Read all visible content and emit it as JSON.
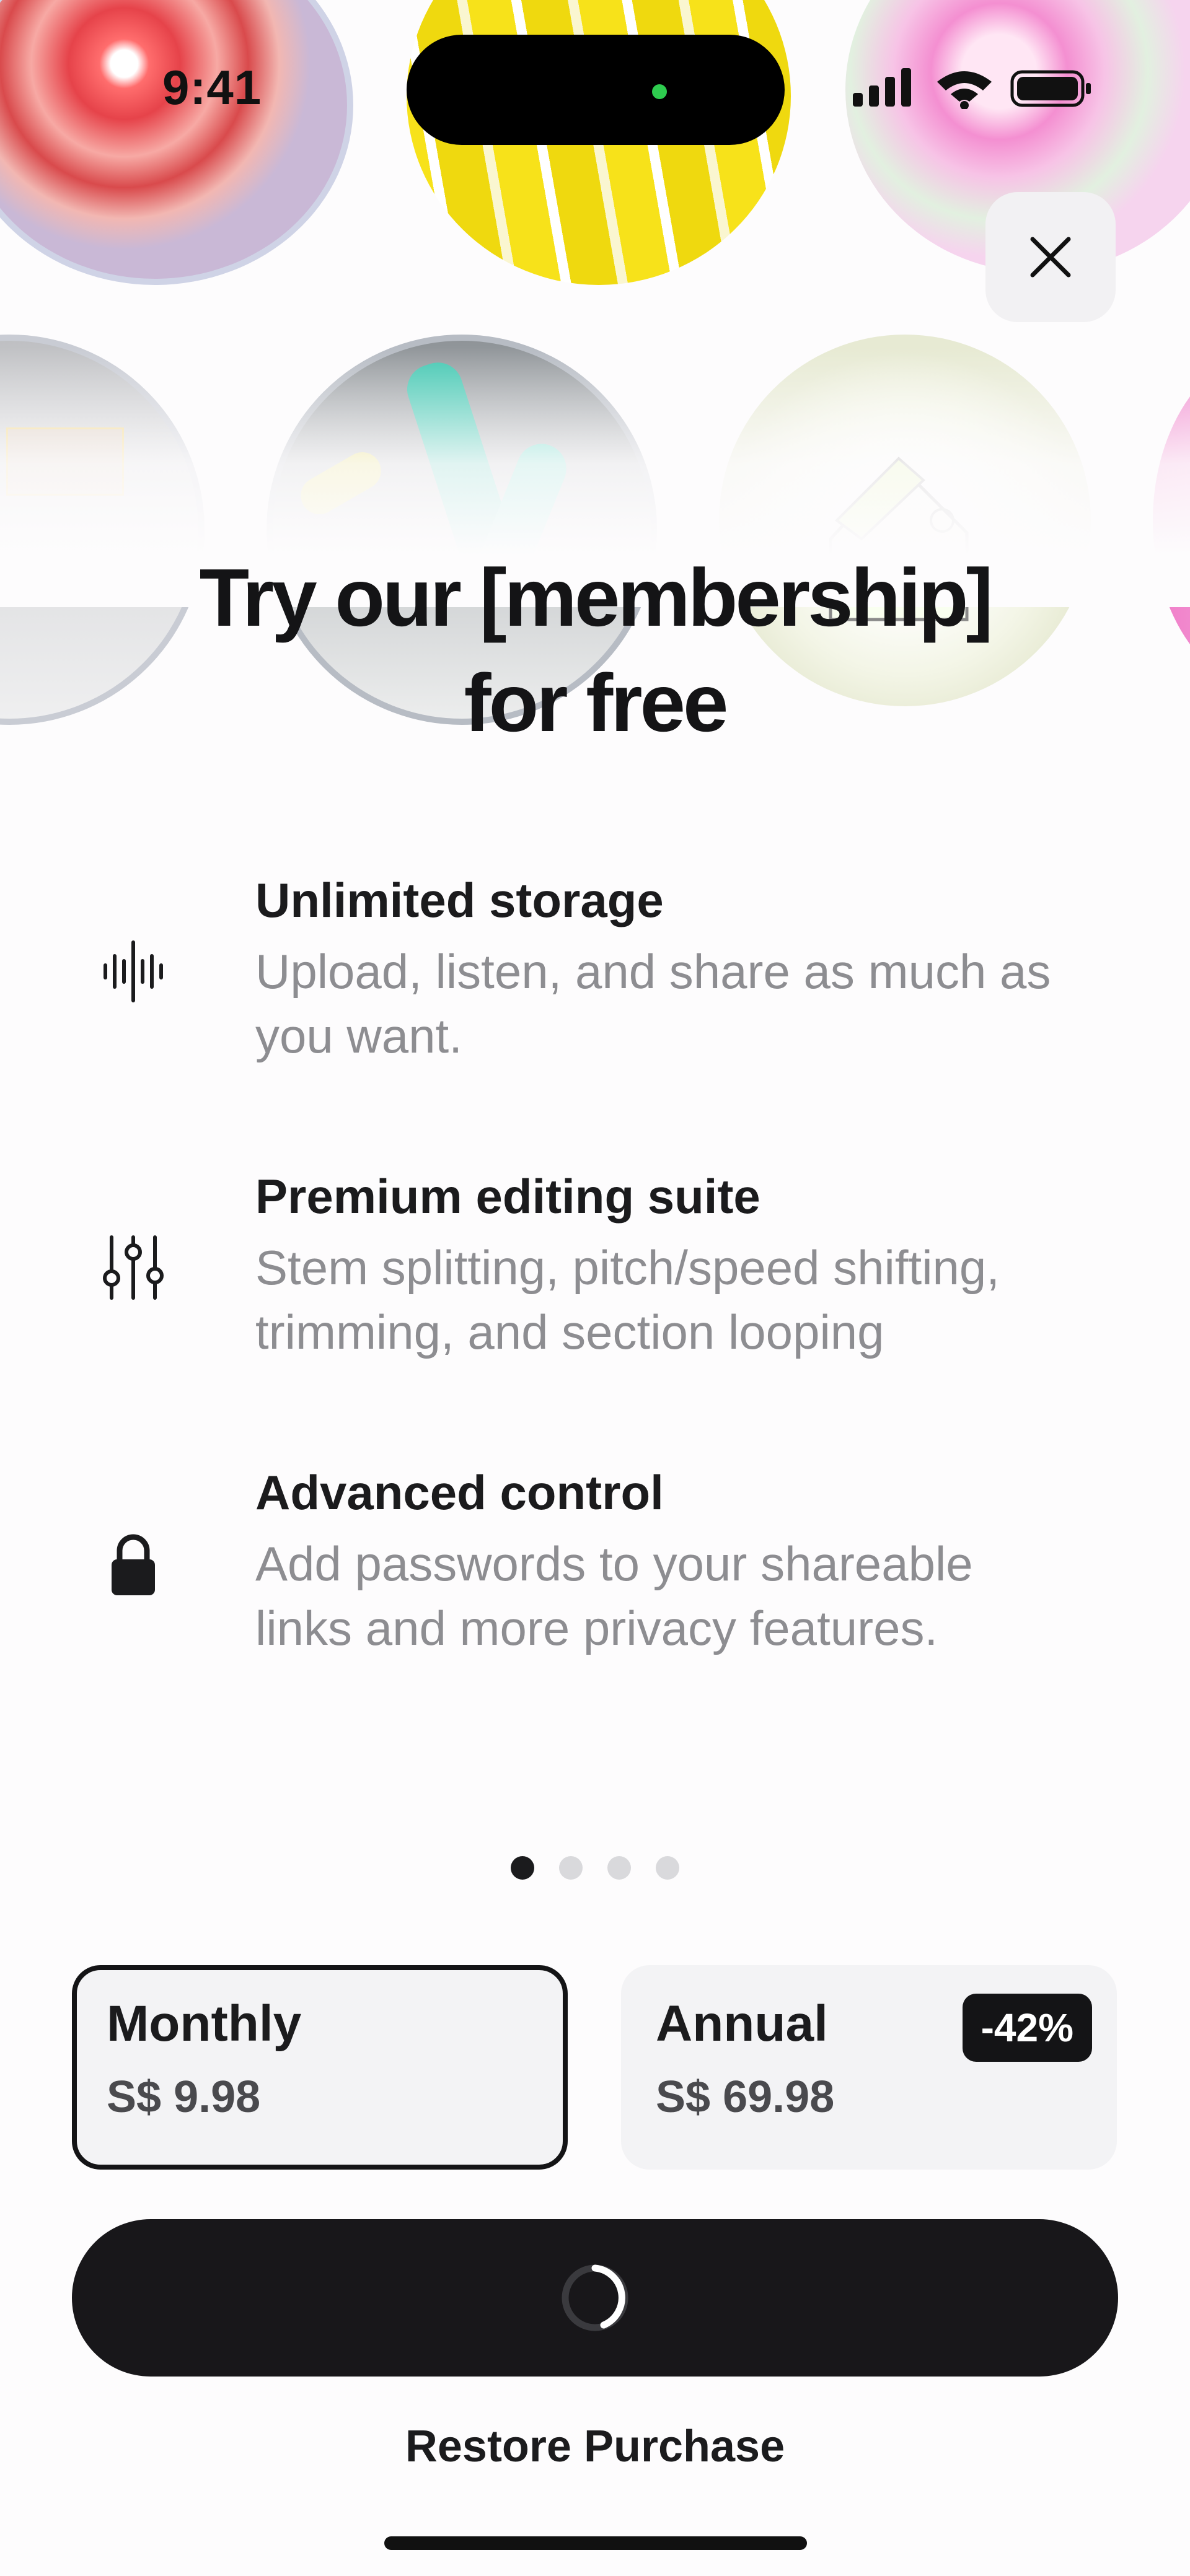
{
  "status_bar": {
    "time": "9:41",
    "icons": [
      "signal-icon",
      "wifi-icon",
      "battery-icon"
    ]
  },
  "artwork": [
    "red-vinyl-art",
    "yellow-art",
    "pink-art",
    "portrait-art",
    "teal-sculpture-art",
    "house-sketch-art",
    "pink-edge-art"
  ],
  "close_button": {
    "icon": "close-icon"
  },
  "title_line1": "Try our [membership]",
  "title_line2": "for free",
  "features": [
    {
      "icon": "waveform-icon",
      "title": "Unlimited storage",
      "desc_line1": "Upload, listen, and share as much as",
      "desc_line2": "you want."
    },
    {
      "icon": "sliders-icon",
      "title": "Premium editing suite",
      "desc_line1": "Stem splitting, pitch/speed shifting,",
      "desc_line2": "trimming, and section looping"
    },
    {
      "icon": "lock-icon",
      "title": "Advanced control",
      "desc_line1": "Add passwords to your shareable",
      "desc_line2": "links and more privacy features."
    }
  ],
  "pagination": {
    "count": 4,
    "active": 1
  },
  "plans": [
    {
      "name": "Monthly",
      "price": "S$ 9.98",
      "selected": true
    },
    {
      "name": "Annual",
      "price": "S$ 69.98",
      "badge": "-42%",
      "selected": false
    }
  ],
  "cta": {
    "state": "loading",
    "icon": "spinner-icon"
  },
  "restore_label": "Restore Purchase",
  "colors": {
    "accent": "#18171a",
    "muted_text": "#8d8d91",
    "card_bg": "#f3f3f5"
  }
}
